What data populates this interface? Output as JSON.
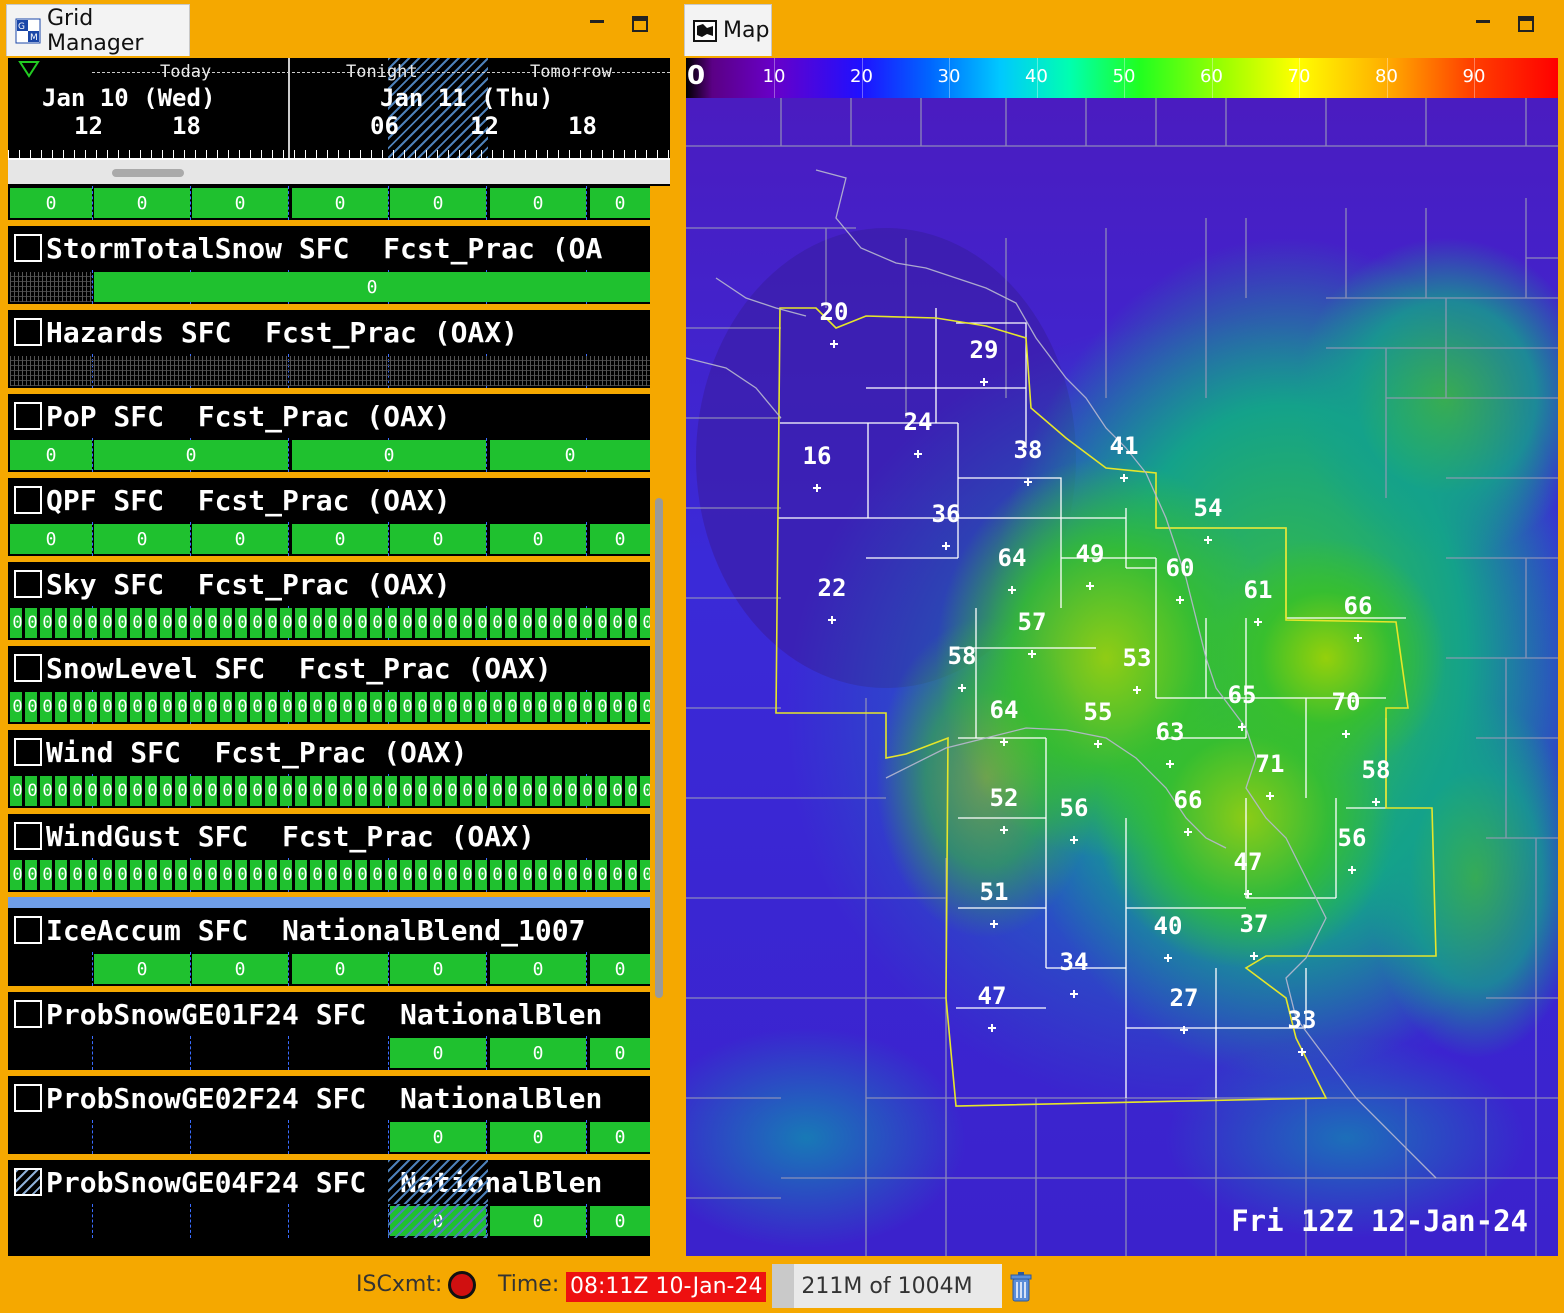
{
  "grid_manager": {
    "title": "Grid Manager",
    "timebar": {
      "periods": [
        "Today",
        "Tonight",
        "Tomorrow"
      ],
      "dates": [
        "Jan 10 (Wed)",
        "Jan 11 (Thu)"
      ],
      "hours": [
        "12",
        "18",
        "06",
        "12",
        "18"
      ]
    },
    "rows": [
      {
        "label": "",
        "boxes": [
          "0",
          "0",
          "0",
          "0",
          "0",
          "0",
          "0"
        ]
      },
      {
        "label": "StormTotalSnow SFC  Fcst_Prac (OA",
        "boxes": [
          "0"
        ]
      },
      {
        "label": "Hazards SFC  Fcst_Prac (OAX)",
        "boxes": []
      },
      {
        "label": "PoP SFC  Fcst_Prac (OAX)",
        "boxes": [
          "0",
          "0",
          "0",
          "0"
        ]
      },
      {
        "label": "QPF SFC  Fcst_Prac (OAX)",
        "boxes": [
          "0",
          "0",
          "0",
          "0",
          "0",
          "0",
          "0"
        ]
      },
      {
        "label": "Sky SFC  Fcst_Prac (OAX)",
        "dense": "0"
      },
      {
        "label": "SnowLevel SFC  Fcst_Prac (OAX)",
        "dense": "0"
      },
      {
        "label": "Wind SFC  Fcst_Prac (OAX)",
        "dense": "0"
      },
      {
        "label": "WindGust SFC  Fcst_Prac (OAX)",
        "dense": "0"
      },
      {
        "label": "IceAccum SFC  NationalBlend_1007",
        "boxes": [
          "0",
          "0",
          "0",
          "0",
          "0",
          "0"
        ]
      },
      {
        "label": "ProbSnowGE01F24 SFC  NationalBlen",
        "boxes": [
          "0",
          "0",
          "0"
        ]
      },
      {
        "label": "ProbSnowGE02F24 SFC  NationalBlen",
        "boxes": [
          "0",
          "0",
          "0"
        ]
      },
      {
        "label": "ProbSnowGE04F24 SFC  NationalBlen",
        "boxes": [
          "0",
          "0",
          "0"
        ]
      }
    ]
  },
  "map": {
    "title": "Map",
    "colorbar": {
      "start_label": "0",
      "labels": [
        "10",
        "20",
        "30",
        "40",
        "50",
        "60",
        "70",
        "80",
        "90"
      ]
    },
    "valid_time": "Fri 12Z 12-Jan-24",
    "station_values": [
      "20",
      "29",
      "24",
      "16",
      "38",
      "41",
      "36",
      "54",
      "64",
      "49",
      "60",
      "22",
      "61",
      "66",
      "57",
      "58",
      "53",
      "65",
      "70",
      "64",
      "55",
      "63",
      "71",
      "58",
      "52",
      "56",
      "66",
      "56",
      "47",
      "51",
      "40",
      "37",
      "34",
      "47",
      "27",
      "33"
    ]
  },
  "status": {
    "isc_label": "ISCxmt:",
    "time_label": "Time:",
    "time_value": "08:11Z 10-Jan-24",
    "memory": "211M of 1004M"
  },
  "icons": {
    "grid_manager": "gm-icon",
    "map": "map-icon",
    "trash": "trash-icon"
  },
  "colors": {
    "frame": "#f5a800",
    "grid_box": "#1fc12f",
    "time_alert": "#ee1010"
  }
}
